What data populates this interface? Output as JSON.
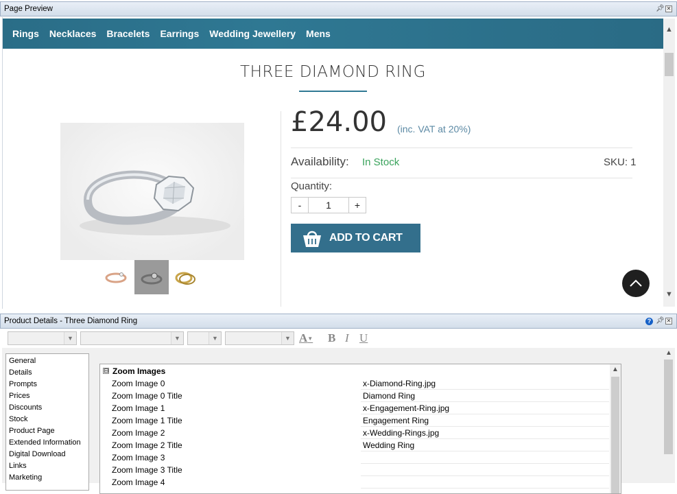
{
  "page_preview": {
    "title": "Page Preview",
    "nav": [
      "Rings",
      "Necklaces",
      "Bracelets",
      "Earrings",
      "Wedding Jewellery",
      "Mens"
    ],
    "product_title": "THREE DIAMOND RING",
    "price": "£24.00",
    "vat_note": "(inc. VAT at 20%)",
    "availability_label": "Availability:",
    "availability_value": "In Stock",
    "sku": "SKU: 1",
    "quantity_label": "Quantity:",
    "quantity_minus": "-",
    "quantity_value": "1",
    "quantity_plus": "+",
    "add_to_cart": "ADD TO CART",
    "colors": {
      "nav_bg": "#2f7893",
      "accent": "#336f8c",
      "in_stock": "#3aa35c"
    }
  },
  "product_details": {
    "title": "Product Details - Three Diamond Ring",
    "toolbar": {
      "bold": "B",
      "italic": "I",
      "underline": "U",
      "font_color": "A"
    },
    "categories": [
      "General",
      "Details",
      "Prompts",
      "Prices",
      "Discounts",
      "Stock",
      "Product Page",
      "Extended Information",
      "Digital Download",
      "Links",
      "Marketing"
    ],
    "group": {
      "toggle": "⊟",
      "label": "Zoom Images"
    },
    "rows": [
      {
        "name": "Zoom Image  0",
        "value": "x-Diamond-Ring.jpg"
      },
      {
        "name": "Zoom Image  0 Title",
        "value": "Diamond Ring"
      },
      {
        "name": "Zoom Image  1",
        "value": "x-Engagement-Ring.jpg"
      },
      {
        "name": "Zoom Image  1 Title",
        "value": "Engagement Ring"
      },
      {
        "name": "Zoom Image  2",
        "value": "x-Wedding-Rings.jpg"
      },
      {
        "name": "Zoom Image  2 Title",
        "value": "Wedding Ring"
      },
      {
        "name": "Zoom Image  3",
        "value": ""
      },
      {
        "name": "Zoom Image  3 Title",
        "value": ""
      },
      {
        "name": "Zoom Image  4",
        "value": ""
      }
    ]
  }
}
